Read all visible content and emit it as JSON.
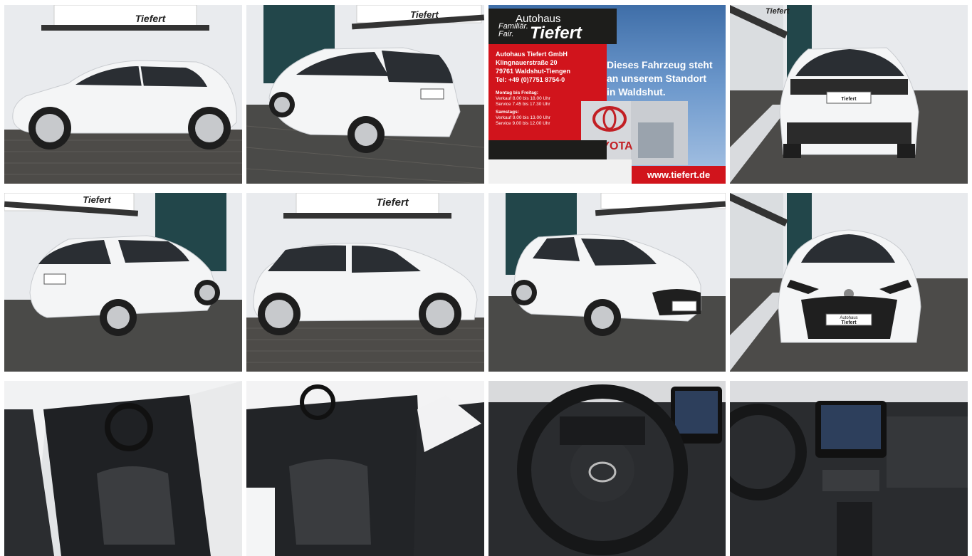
{
  "gallery": {
    "tiles": [
      {
        "id": "t1",
        "view": "side-left"
      },
      {
        "id": "t2",
        "view": "rear-three-quarter-left"
      },
      {
        "id": "t3",
        "view": "dealer-advert"
      },
      {
        "id": "t4",
        "view": "rear"
      },
      {
        "id": "t5",
        "view": "rear-three-quarter-left-2"
      },
      {
        "id": "t6",
        "view": "side-right"
      },
      {
        "id": "t7",
        "view": "front-three-quarter-right"
      },
      {
        "id": "t8",
        "view": "front"
      },
      {
        "id": "t9",
        "view": "interior-driver-door"
      },
      {
        "id": "t10",
        "view": "interior-passenger-door"
      },
      {
        "id": "t11",
        "view": "steering-wheel"
      },
      {
        "id": "t12",
        "view": "dashboard"
      }
    ]
  },
  "sign": {
    "autohaus": "Autohaus",
    "familiar": "Familiär.",
    "fair": "Fair.",
    "tiefert": "Tiefert"
  },
  "plate": {
    "line1": "Autohaus",
    "line2": "Tiefert"
  },
  "ad": {
    "header_autohaus": "Autohaus",
    "header_familiar": "Familiär.",
    "header_fair": "Fair.",
    "header_tiefert": "Tiefert",
    "company": "Autohaus Tiefert GmbH",
    "street": "Klingnauerstraße 20",
    "city": "79761 Waldshut-Tiengen",
    "phone": "Tel: +49 (0)7751 8754-0",
    "weekdays_title": "Montag bis Freitag:",
    "weekdays_sales": "Verkauf        8.00 bis 18.00 Uhr",
    "weekdays_service": "Service         7.45 bis 17.30 Uhr",
    "saturday_title": "Samstags:",
    "saturday_sales": "Verkauf        9.00 bis 13.00 Uhr",
    "saturday_service": "Service         9.00 bis 12.00 Uhr",
    "message_line1": "Dieses Fahrzeug steht",
    "message_line2": "an unserem Standort",
    "message_line3": "in Waldshut.",
    "dealer_sign": "TOYOTA",
    "url": "www.tiefert.de"
  },
  "colors": {
    "car_white": "#f4f5f6",
    "wall": "#e9ebee",
    "glass": "#2a2e33",
    "pavement": "#4a4a48",
    "tiefert_red": "#d1141c",
    "dark": "#1d1d1b"
  }
}
